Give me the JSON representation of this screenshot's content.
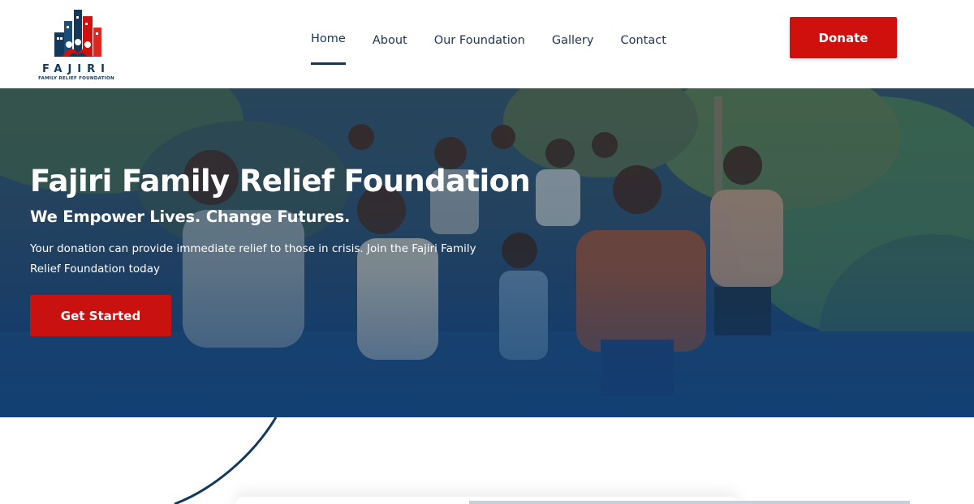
{
  "brand": {
    "name": "FAJIRI",
    "tagline": "FAMILY RELIEF FOUNDATION",
    "colors": {
      "navy": "#12385e",
      "red": "#d0100c"
    }
  },
  "nav": {
    "items": [
      {
        "label": "Home",
        "active": true
      },
      {
        "label": "About",
        "active": false
      },
      {
        "label": "Our Foundation",
        "active": false
      },
      {
        "label": "Gallery",
        "active": false
      },
      {
        "label": "Contact",
        "active": false
      }
    ],
    "donate_label": "Donate"
  },
  "hero": {
    "title": "Fajiri Family Relief Foundation",
    "subtitle": "We Empower Lives. Change Futures.",
    "text": "Your donation can provide immediate relief to those in crisis. Join the Fajiri Family Relief Foundation today",
    "cta_label": "Get Started",
    "image": "children-running-photo"
  }
}
